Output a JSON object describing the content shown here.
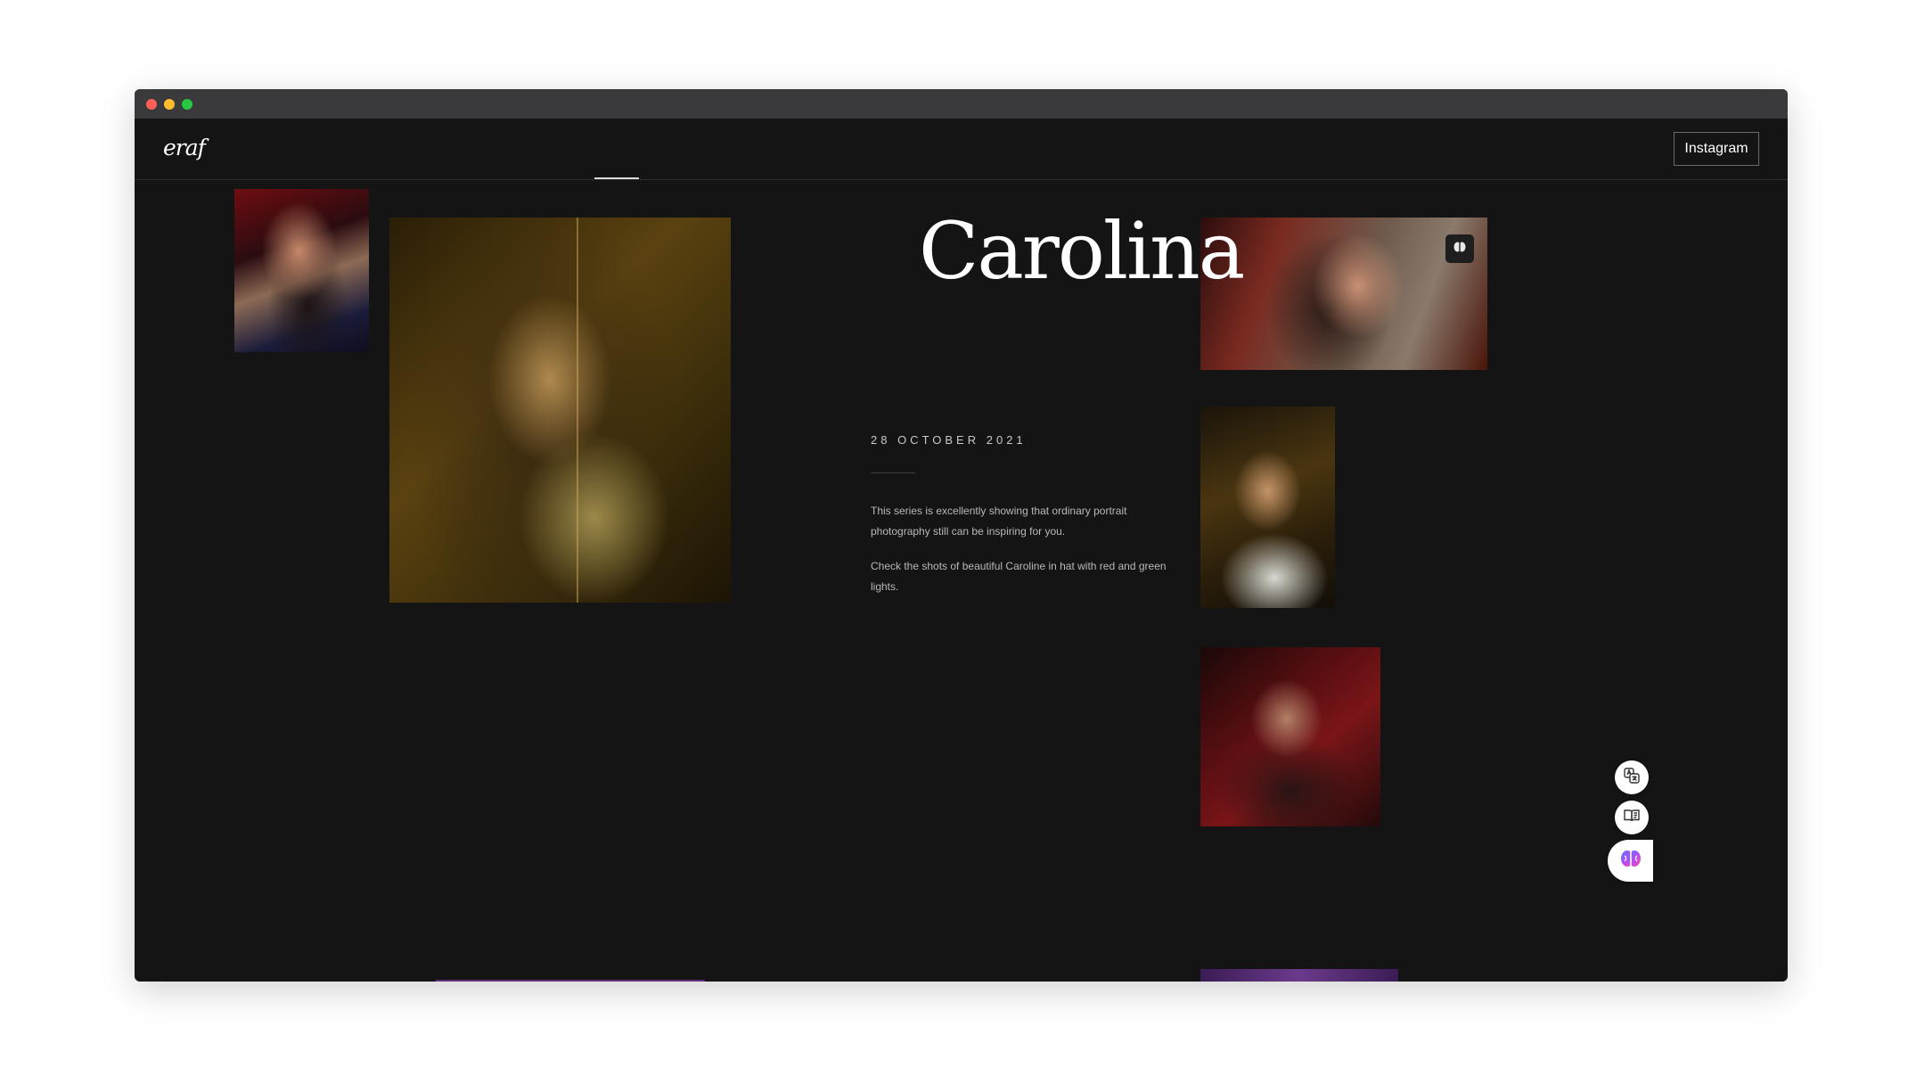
{
  "header": {
    "logo": "eraf",
    "instagram_label": "Instagram"
  },
  "post": {
    "title": "Carolina",
    "date": "28 OCTOBER 2021",
    "paragraphs": [
      "This series is excellently showing that ordinary portrait photography still can be inspiring for you.",
      "Check the shots of beautiful Caroline in hat with red and green lights."
    ]
  },
  "gallery": {
    "images": [
      "portrait-red-lights",
      "portrait-green-light",
      "portrait-hat-window",
      "portrait-white-top",
      "portrait-red-room",
      "portrait-purple",
      "portrait-purple-2"
    ]
  },
  "icons": {
    "image_badge": "brain-icon",
    "side_tools": [
      "translate-icon",
      "reader-icon",
      "brain-icon"
    ]
  },
  "colors": {
    "background": "#141414",
    "titlebar": "#3a3a3c",
    "text_primary": "#ffffff",
    "text_secondary": "#b9b9b9"
  }
}
